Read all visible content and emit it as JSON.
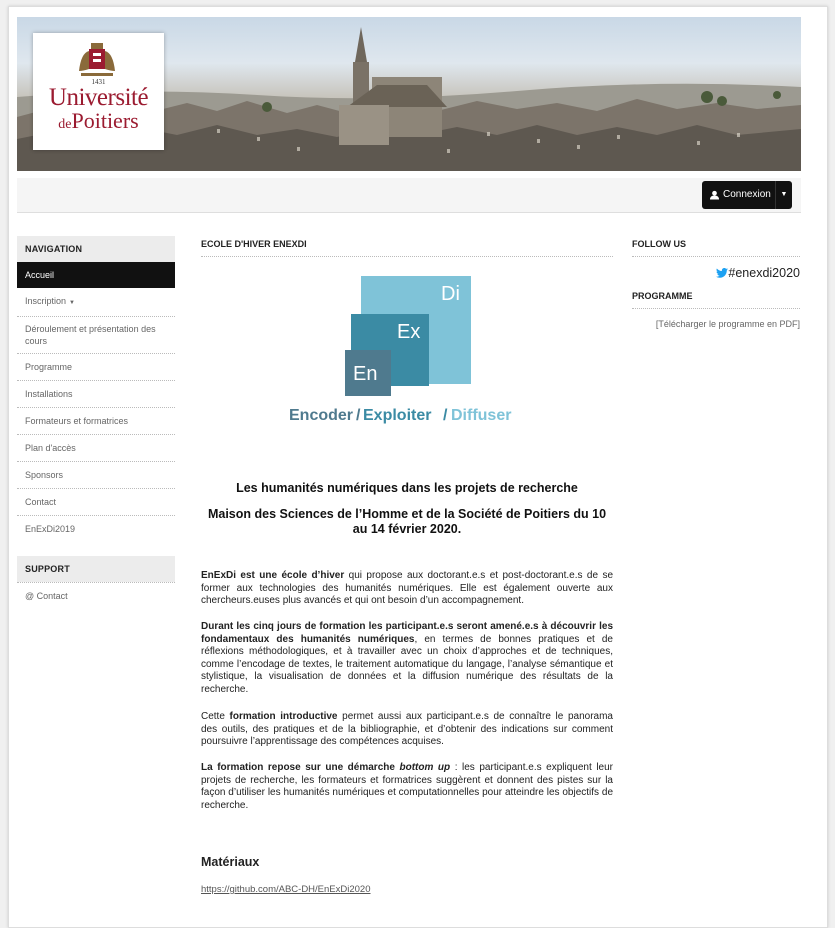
{
  "banner": {
    "logo": {
      "year": "1431",
      "line1": "Université",
      "line2_prefix": "de",
      "line2": "Poitiers"
    }
  },
  "topbar": {
    "login_label": "Connexion"
  },
  "navigation": {
    "heading": "NAVIGATION",
    "items": [
      {
        "label": "Accueil",
        "active": true
      },
      {
        "label": "Inscription",
        "dropdown": true
      },
      {
        "label": "Déroulement et présentation des cours"
      },
      {
        "label": "Programme"
      },
      {
        "label": "Installations"
      },
      {
        "label": "Formateurs et formatrices"
      },
      {
        "label": "Plan d'accès"
      },
      {
        "label": "Sponsors"
      },
      {
        "label": "Contact"
      },
      {
        "label": "EnExDi2019"
      }
    ]
  },
  "support": {
    "heading": "SUPPORT",
    "contact_label": "@ Contact"
  },
  "main": {
    "heading": "ECOLE D'HIVER ENEXDI",
    "logo": {
      "di": "Di",
      "ex": "Ex",
      "en": "En",
      "encoder": "Encoder",
      "exploiter": "Exploiter",
      "diffuser": "Diffuser"
    },
    "subtitle1": "Les humanités numériques dans les projets de recherche",
    "subtitle2": "Maison des Sciences de l’Homme et de la Société de Poitiers du 10 au 14 février 2020.",
    "p1_b": "EnExDi est une école d’hiver",
    "p1_t": " qui propose aux doctorant.e.s et post-doctorant.e.s de se former aux technologies des humanités numériques. Elle est également ouverte aux chercheurs.euses plus avancés et qui ont besoin d’un accompagnement.",
    "p2_b": "Durant les cinq jours de formation les participant.e.s seront amené.e.s à découvrir les fondamentaux des humanités numériques",
    "p2_t": ", en termes de bonnes pratiques et de réflexions méthodologiques, et à travailler avec un choix d’approches et de techniques, comme l’encodage de textes, le traitement automatique du langage, l’analyse sémantique et stylistique, la visualisation de données et la diffusion numérique des résultats de la recherche.",
    "p3_a": "Cette ",
    "p3_b": "formation introductive",
    "p3_t": " permet aussi aux participant.e.s de connaître le panorama des outils, des pratiques et de la bibliographie, et d’obtenir des indications sur comment poursuivre l’apprentissage des compétences acquises.",
    "p4_b": "La formation repose sur une démarche ",
    "p4_bi": "bottom up",
    "p4_t": " : les participant.e.s expliquent leur projets de recherche, les formateurs et formatrices suggèrent et donnent des pistes sur la façon d’utiliser les humanités numériques et computationnelles pour atteindre les objectifs de recherche.",
    "materials_heading": "Matériaux",
    "materials_link": "https://github.com/ABC-DH/EnExDi2020"
  },
  "right": {
    "follow_heading": "FOLLOW US",
    "twitter_tag": "#enexdi2020",
    "program_heading": "PROGRAMME",
    "pdf_open": "[",
    "pdf_link": "Télécharger le programme en PDF",
    "pdf_close": "]"
  },
  "colors": {
    "brand": "#9b1b30",
    "nav_active": "#111111",
    "twitter": "#1da1f2",
    "logo_light": "#7fc3d8",
    "logo_mid": "#3b8ba4",
    "logo_dark": "#4f7a8e"
  }
}
